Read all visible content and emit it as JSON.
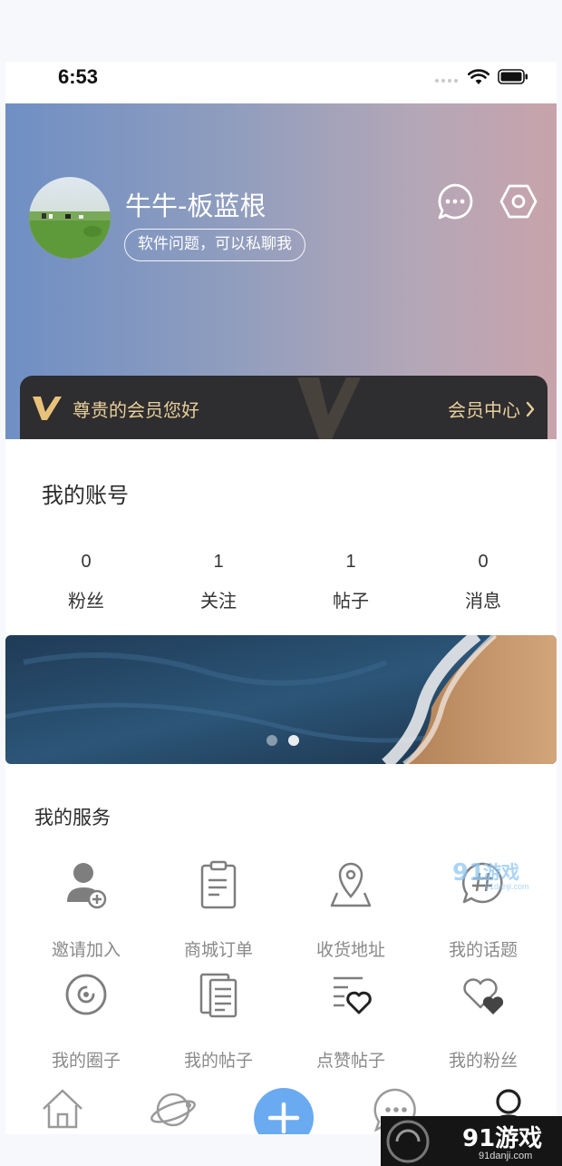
{
  "status_bar": {
    "time": "6:53"
  },
  "profile": {
    "username": "牛牛-板蓝根",
    "bio": "软件问题，可以私聊我"
  },
  "vip": {
    "greeting": "尊贵的会员您好",
    "center_label": "会员中心"
  },
  "account": {
    "title": "我的账号",
    "stats": [
      {
        "value": "0",
        "label": "粉丝"
      },
      {
        "value": "1",
        "label": "关注"
      },
      {
        "value": "1",
        "label": "帖子"
      },
      {
        "value": "0",
        "label": "消息"
      }
    ]
  },
  "banner": {
    "slide_count": 2,
    "active_slide": 2
  },
  "services": {
    "title": "我的服务",
    "items": [
      {
        "label": "邀请加入",
        "icon": "add-user-icon"
      },
      {
        "label": "商城订单",
        "icon": "clipboard-icon"
      },
      {
        "label": "收货地址",
        "icon": "location-pin-icon"
      },
      {
        "label": "我的话题",
        "icon": "hashtag-chat-icon"
      },
      {
        "label": "我的圈子",
        "icon": "circle-icon"
      },
      {
        "label": "我的帖子",
        "icon": "documents-icon"
      },
      {
        "label": "点赞帖子",
        "icon": "list-heart-icon"
      },
      {
        "label": "我的粉丝",
        "icon": "hearts-icon"
      }
    ]
  },
  "tabbar": {
    "tabs": [
      "home-icon",
      "planet-icon",
      "plus-icon",
      "chat-icon",
      "profile-icon"
    ],
    "accent": "#6aaaf1"
  },
  "watermark": {
    "text": "91游戏",
    "sub": "91danji.com"
  },
  "colors": {
    "gold": "#e8cf9a",
    "vip_bg": "#2e2d30",
    "gradient_left": "#6f8fc4",
    "gradient_right": "#c8a3ab"
  }
}
